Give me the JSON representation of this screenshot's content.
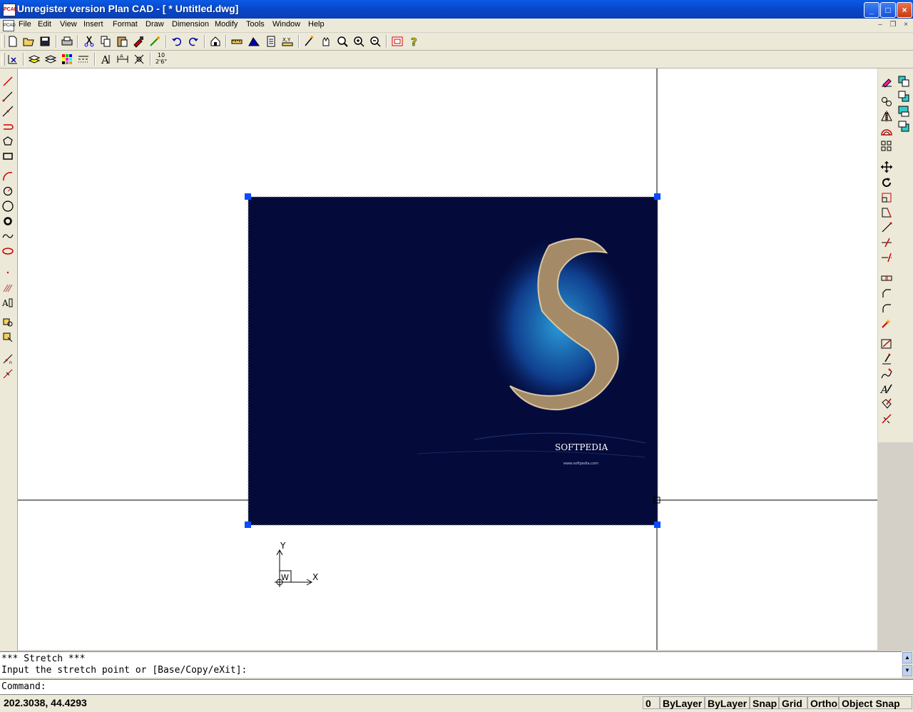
{
  "window": {
    "title": "Unregister version Plan CAD - [ * Untitled.dwg]",
    "app_icon_label": "PCAD",
    "controls": [
      "_",
      "□",
      "×"
    ]
  },
  "menu": {
    "items": [
      "File",
      "Edit",
      "View",
      "Insert",
      "Format",
      "Draw",
      "Dimension",
      "Modify",
      "Tools",
      "Window",
      "Help"
    ],
    "mdi_controls": [
      "–",
      "❐",
      "×"
    ]
  },
  "toolbar2": {
    "scale_label_top": "10",
    "scale_label_bottom": "2'6\""
  },
  "image_object": {
    "brand": "SOFTPEDIA",
    "url": "www.softpedia.com",
    "colors": {
      "background": "#040a3a",
      "grip": "#0a4cff"
    }
  },
  "ucs": {
    "y_label": "Y",
    "x_label": "X",
    "w_label": "W"
  },
  "command": {
    "history": [
      "*** Stretch ***",
      "Input the stretch point or [Base/Copy/eXit]:"
    ],
    "prompt": "Command:"
  },
  "status": {
    "coordinates": "202.3038, 44.4293",
    "cells": [
      "0",
      "ByLayer",
      "ByLayer",
      "Snap",
      "Grid",
      "Ortho",
      "Object Snap"
    ]
  }
}
